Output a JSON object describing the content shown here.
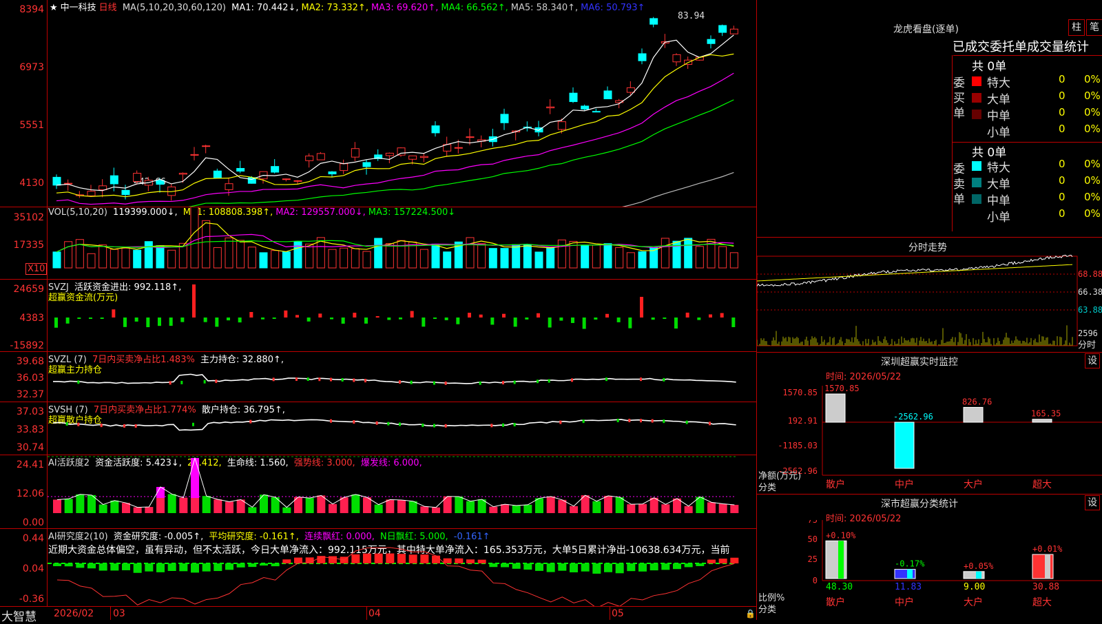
{
  "stock": {
    "star": "★",
    "name": "中一科技",
    "period": "日线"
  },
  "ma_header": {
    "label": "MA(5,10,20,30,60,120)",
    "items": [
      {
        "text": "MA1: 70.442↓,",
        "color": "#ffffff"
      },
      {
        "text": "MA2: 73.332↑,",
        "color": "#ffff00"
      },
      {
        "text": "MA3: 69.620↑,",
        "color": "#ff00ff"
      },
      {
        "text": "MA4: 66.562↑,",
        "color": "#00ff00"
      },
      {
        "text": "MA5: 58.340↑,",
        "color": "#cccccc"
      },
      {
        "text": "MA6: 50.793↑",
        "color": "#3333ff"
      }
    ],
    "high_label": "83.94",
    "low_label": "←42.66"
  },
  "vol_header": {
    "label": "VOL(5,10,20)",
    "value": "119399.000↓,",
    "items": [
      {
        "text": "MA1: 108808.398↑,",
        "color": "#ffff00"
      },
      {
        "text": "MA2: 129557.000↓,",
        "color": "#ff00ff"
      },
      {
        "text": "MA3: 157224.500↓",
        "color": "#00ff00"
      }
    ],
    "multiplier": "X10"
  },
  "svzj_header": {
    "label": "SVZJ",
    "text1": "活跃资金进出: 992.118↑,",
    "text2": "超赢资金流(万元)"
  },
  "svzl_header": {
    "label": "SVZL (7)",
    "text1": "7日内买卖净占比1.483%",
    "text2": "主力持仓: 32.880↑,",
    "text3": "超赢主力持仓"
  },
  "svsh_header": {
    "label": "SVSH (7)",
    "text1": "7日内买卖净占比1.774%",
    "text2": "散户持仓: 36.795↑,",
    "text3": "超赢散户持仓"
  },
  "ai_active_header": {
    "label": "AI活跃度2",
    "text1": "资金活跃度: 5.423↓,",
    "text2": "24.412,",
    "text3": "生命线: 1.560,",
    "text4": "强势线: 3.000,",
    "text5": "爆发线: 6.000,"
  },
  "ai_research_header": {
    "label": "AI研究度2(10)",
    "text1": "资金研究度: -0.005↑,",
    "text2": "平均研究度: -0.161↑,",
    "text3": "连续飘红: 0.000,",
    "text4": "N日飘红: 5.000,",
    "text5": "-0.161↑",
    "comment": "近期大资金总体偏空，虽有异动，但不太活跃，今日大单净流入：992.115万元，其中特大单净流入：165.353万元，大单5日累计净出-10638.634万元，当前"
  },
  "y_axis": {
    "price": [
      "8394",
      "6973",
      "5551",
      "4130"
    ],
    "vol": [
      "35102",
      "17335"
    ],
    "svzj": [
      "24659",
      "4383",
      "-15892"
    ],
    "svzl": [
      "39.68",
      "36.03",
      "32.37"
    ],
    "svsh": [
      "37.03",
      "33.83",
      "30.74"
    ],
    "ai_active": [
      "24.41",
      "12.06",
      "0.00"
    ],
    "ai_research": [
      "0.44",
      "0.04",
      "-0.36"
    ]
  },
  "x_axis": {
    "labels": [
      "2026/02",
      "03",
      "04",
      "05"
    ]
  },
  "brand": "大智慧",
  "right": {
    "dragon_title": "龙虎看盘(逐单)",
    "btn_bar": "柱",
    "btn_stroke": "笔",
    "stats_tabs": "已成交委托单成交量统计",
    "buy_label": "委买单",
    "sell_label": "委卖单",
    "buy_total": "共 0单",
    "sell_total": "共 0单",
    "buy_rows": [
      {
        "name": "特大",
        "count": "0",
        "pct": "0%",
        "color": "#ff0000"
      },
      {
        "name": "大单",
        "count": "0",
        "pct": "0%",
        "color": "#990000"
      },
      {
        "name": "中单",
        "count": "0",
        "pct": "0%",
        "color": "#660000"
      },
      {
        "name": "小单",
        "count": "0",
        "pct": "0%",
        "color": "#000000"
      }
    ],
    "sell_rows": [
      {
        "name": "特大",
        "count": "0",
        "pct": "0%",
        "color": "#00ffff"
      },
      {
        "name": "大单",
        "count": "0",
        "pct": "0%",
        "color": "#008080"
      },
      {
        "name": "中单",
        "count": "0",
        "pct": "0%",
        "color": "#006666"
      },
      {
        "name": "小单",
        "count": "0",
        "pct": "0%",
        "color": "#000000"
      }
    ],
    "intraday_title": "分时走势",
    "intraday_y": [
      "68.88",
      "66.38",
      "63.88"
    ],
    "intraday_vol": "2596",
    "intraday_unit": "分时",
    "sz_title": "深圳超赢实时监控",
    "sz_time": "时间: 2026/05/22",
    "sz_btn": "设",
    "sz_y": [
      "1570.85",
      "192.91",
      "-1185.03",
      "-2562.96"
    ],
    "sz_axis_title": "净额(万元)",
    "sz_axis_title2": "分类",
    "sz_categories": [
      "散户",
      "中户",
      "大户",
      "超大"
    ],
    "sz_values": [
      1570.85,
      -2562.96,
      826.76,
      165.35
    ],
    "sz_value_labels": [
      "1570.85",
      "-2562.96",
      "826.76",
      "165.35"
    ],
    "sh_title": "深市超赢分类统计",
    "sh_time": "时间: 2026/05/22",
    "sh_btn": "设",
    "sh_y": [
      "75",
      "50",
      "25",
      "0"
    ],
    "sh_axis_title": "比例%",
    "sh_axis_title2": "分类",
    "sh_categories": [
      "散户",
      "中户",
      "大户",
      "超大"
    ],
    "sh_values": [
      48.3,
      11.83,
      9.0,
      30.88
    ],
    "sh_value_labels": [
      "48.30",
      "11.83",
      "9.00",
      "30.88"
    ],
    "sh_change_labels": [
      "+0.10%",
      "-0.17%",
      "+0.05%",
      "+0.01%"
    ]
  },
  "chart_data": [
    {
      "type": "candlestick",
      "title": "中一科技 日线",
      "yticks": [
        8394,
        6973,
        5551,
        4130
      ],
      "high_marker": 83.94,
      "low_marker": 42.66
    },
    {
      "type": "bar",
      "title": "VOL(5,10,20)",
      "yticks": [
        35102,
        17335
      ]
    },
    {
      "type": "bar",
      "title": "深圳超赢实时监控",
      "categories": [
        "散户",
        "中户",
        "大户",
        "超大"
      ],
      "values": [
        1570.85,
        -2562.96,
        826.76,
        165.35
      ],
      "ylim": [
        -2562.96,
        1570.85
      ]
    },
    {
      "type": "bar",
      "title": "深市超赢分类统计",
      "categories": [
        "散户",
        "中户",
        "大户",
        "超大"
      ],
      "values": [
        48.3,
        11.83,
        9.0,
        30.88
      ],
      "ylim": [
        0,
        75
      ]
    }
  ]
}
